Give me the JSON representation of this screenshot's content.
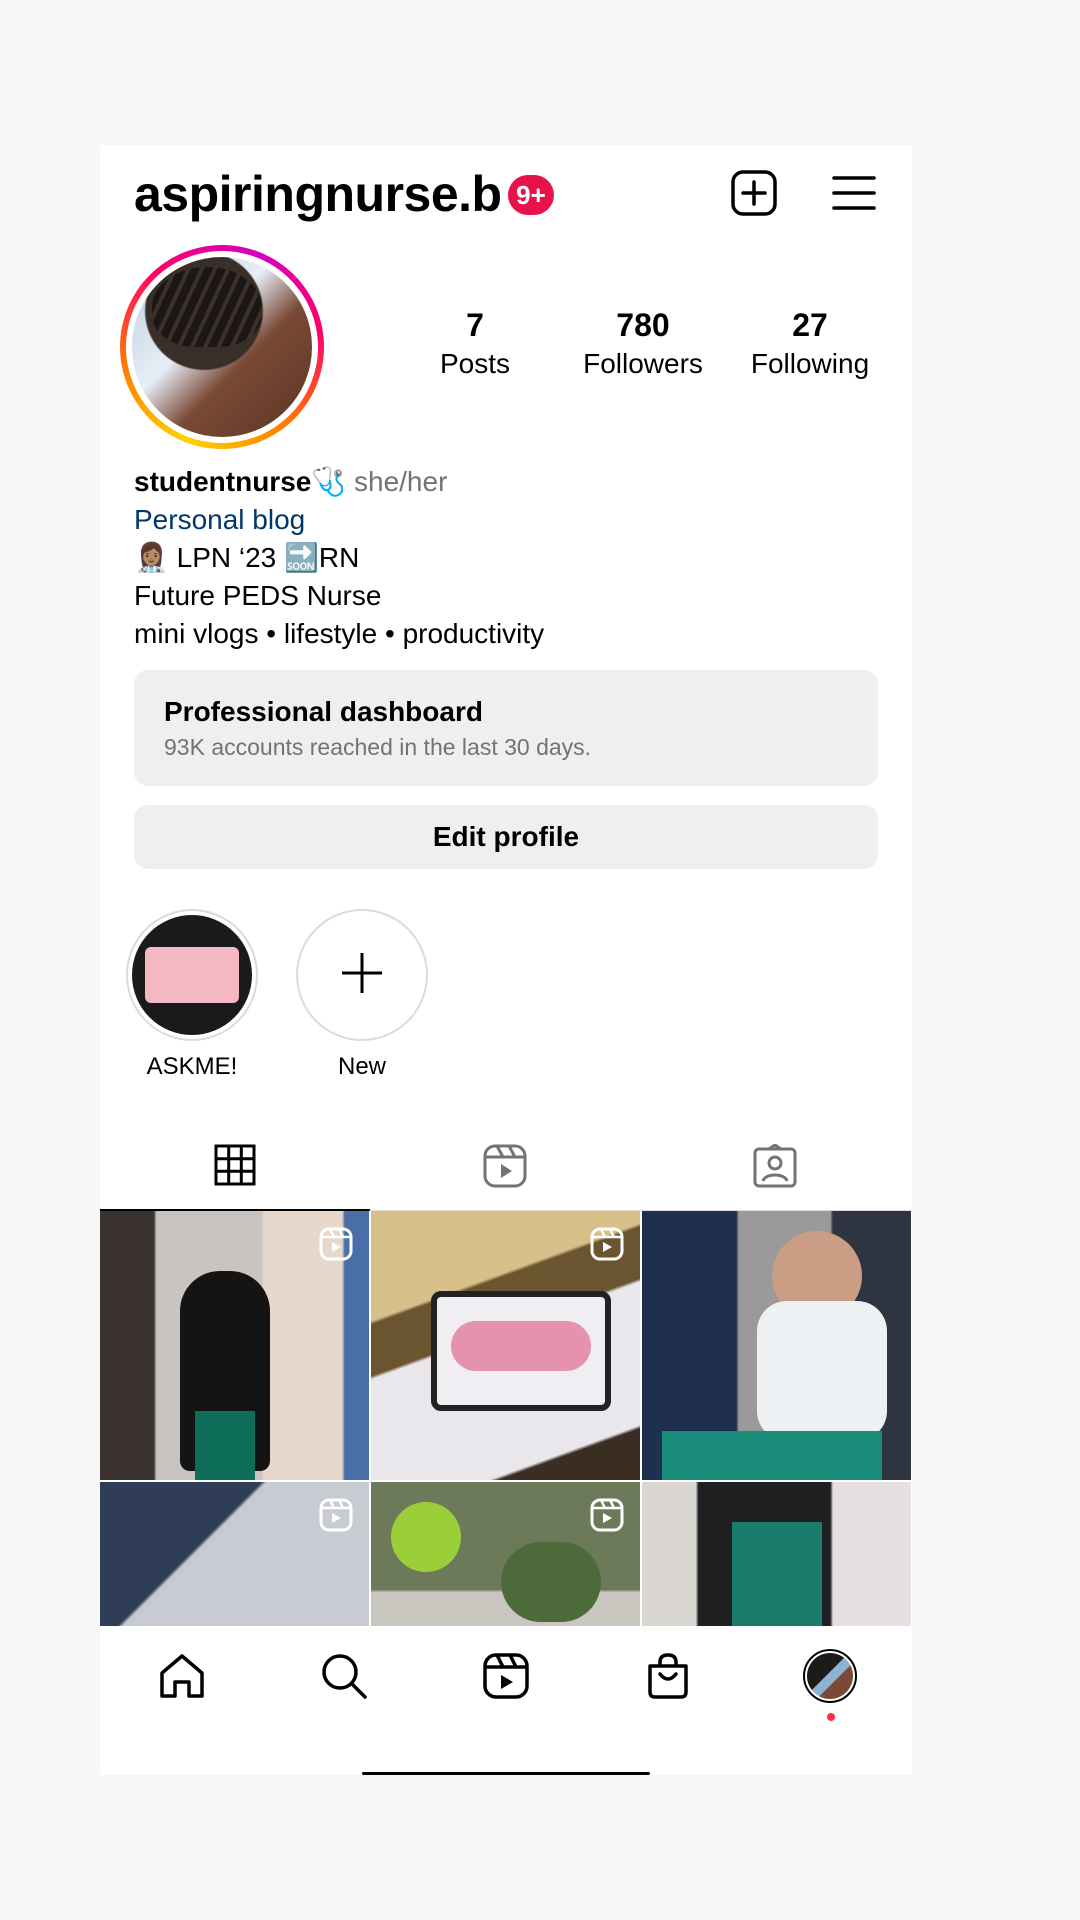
{
  "header": {
    "username": "aspiringnurse.b",
    "notification_badge": "9+"
  },
  "profile": {
    "stats": [
      {
        "value": "7",
        "label": "Posts"
      },
      {
        "value": "780",
        "label": "Followers"
      },
      {
        "value": "27",
        "label": "Following"
      }
    ],
    "bio": {
      "name": "studentnurse🩺",
      "pronouns": "she/her",
      "category": "Personal blog",
      "line1": "👩🏽‍⚕️ LPN ‘23 🔜RN",
      "line2": "Future PEDS Nurse",
      "line3": "mini vlogs • lifestyle • productivity"
    }
  },
  "dashboard": {
    "title": "Professional dashboard",
    "subtitle": "93K accounts reached in the last 30 days."
  },
  "edit_profile_label": "Edit profile",
  "highlights": [
    {
      "label": "ASKME!"
    },
    {
      "label": "New"
    }
  ],
  "tabs": [
    {
      "name": "grid",
      "icon": "grid-icon",
      "active": true
    },
    {
      "name": "reels",
      "icon": "reels-icon",
      "active": false
    },
    {
      "name": "tagged",
      "icon": "tagged-icon",
      "active": false
    }
  ],
  "bottom_nav": [
    "home-icon",
    "search-icon",
    "reels-icon",
    "shop-icon",
    "profile-avatar"
  ],
  "colors": {
    "badge": "#e8124b",
    "link": "#00376b",
    "button_bg": "#efefef",
    "notification_dot": "#ff3040"
  }
}
